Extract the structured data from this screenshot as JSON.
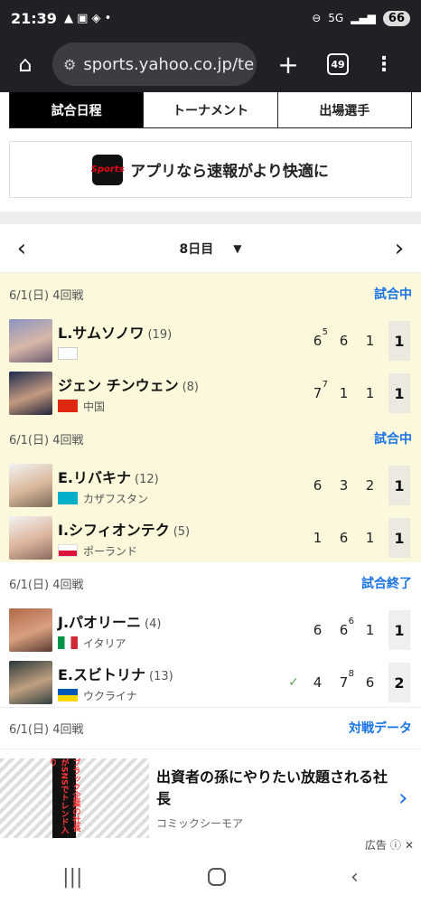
{
  "status": {
    "time": "21:39",
    "icons": "▲ ▣ ◈ •",
    "network": "5G",
    "battery": "66"
  },
  "browser": {
    "url": "sports.yahoo.co.jp/te",
    "tab_count": "49"
  },
  "tabs": [
    "試合日程",
    "トーナメント",
    "出場選手"
  ],
  "app_banner": {
    "logo_top": "Sports",
    "logo_bottom": "navi",
    "text": "アプリなら速報がより快適に"
  },
  "day_nav": {
    "label": "8日目",
    "prev": "‹",
    "next": "›"
  },
  "matches": [
    {
      "header": "6/1(日) 4回戦",
      "status": "試合中",
      "players": [
        {
          "name": "L.サムソノワ",
          "seed": "(19)",
          "country": "",
          "sets": [
            {
              "v": "6",
              "tb": "5"
            },
            {
              "v": "6"
            },
            {
              "v": "1"
            }
          ],
          "total": "1"
        },
        {
          "name": "ジェン チンウェン",
          "seed": "(8)",
          "country": "中国",
          "sets": [
            {
              "v": "7",
              "tb": "7"
            },
            {
              "v": "1"
            },
            {
              "v": "1"
            }
          ],
          "total": "1"
        }
      ]
    },
    {
      "header": "6/1(日) 4回戦",
      "status": "試合中",
      "players": [
        {
          "name": "E.リバキナ",
          "seed": "(12)",
          "country": "カザフスタン",
          "sets": [
            {
              "v": "6"
            },
            {
              "v": "3"
            },
            {
              "v": "2"
            }
          ],
          "total": "1"
        },
        {
          "name": "I.シフィオンテク",
          "seed": "(5)",
          "country": "ポーランド",
          "sets": [
            {
              "v": "1"
            },
            {
              "v": "6"
            },
            {
              "v": "1"
            }
          ],
          "total": "1"
        }
      ]
    },
    {
      "header": "6/1(日) 4回戦",
      "status": "試合終了",
      "players": [
        {
          "name": "J.パオリーニ",
          "seed": "(4)",
          "country": "イタリア",
          "sets": [
            {
              "v": "6"
            },
            {
              "v": "6",
              "tb": "6"
            },
            {
              "v": "1"
            }
          ],
          "total": "1"
        },
        {
          "name": "E.スビトリナ",
          "seed": "(13)",
          "country": "ウクライナ",
          "sets": [
            {
              "v": "4"
            },
            {
              "v": "7",
              "tb": "8"
            },
            {
              "v": "6"
            }
          ],
          "total": "2",
          "winner": "✓"
        }
      ]
    },
    {
      "header": "6/1(日) 4回戦",
      "status": "対戦データ"
    }
  ],
  "ad": {
    "title": "出資者の孫にやりたい放題される社長",
    "source": "コミックシーモア",
    "image_text": "ブラック企業の社長がSNSでトレンド入り",
    "label": "広告"
  },
  "colors": {
    "live_bg": "#fbf8dc",
    "link": "#1a73e8"
  }
}
